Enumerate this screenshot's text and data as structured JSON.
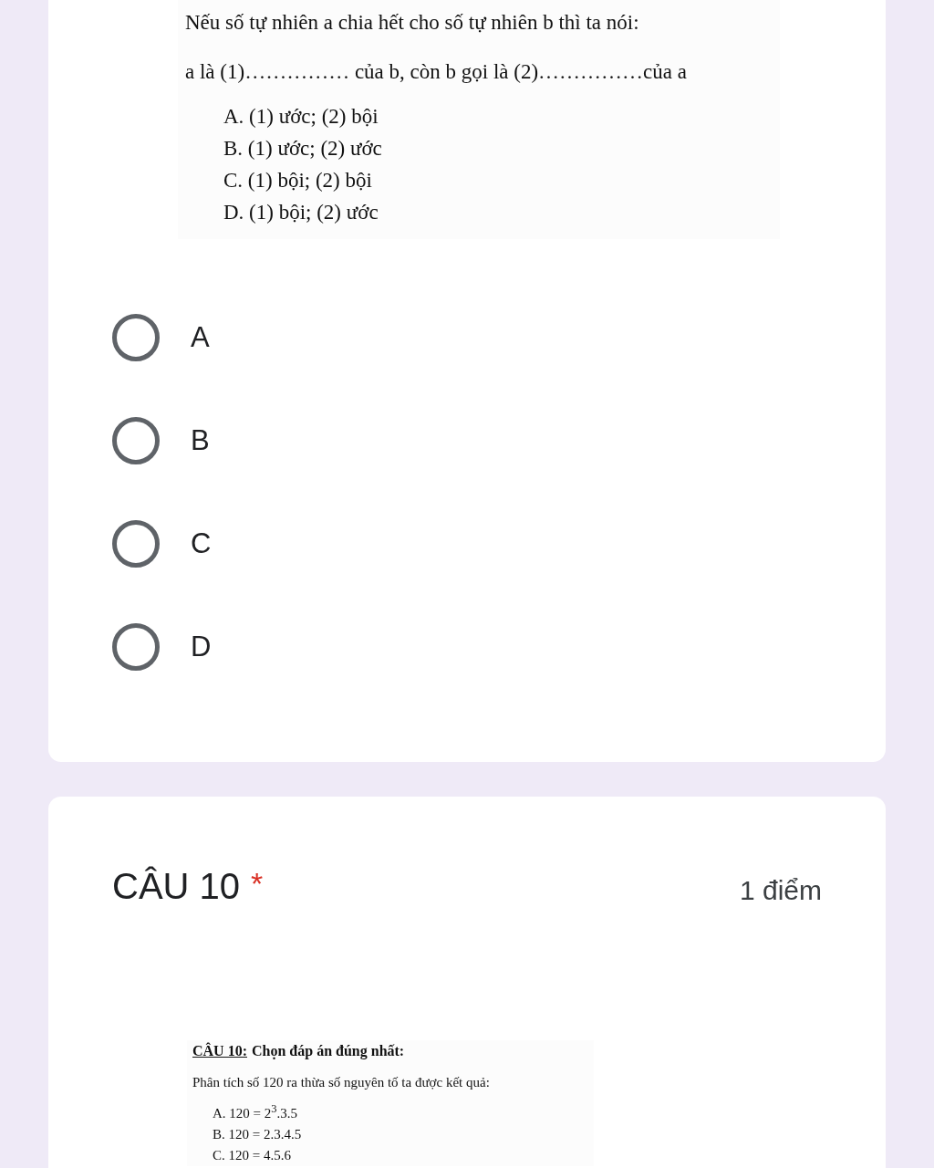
{
  "question_9": {
    "image_text": {
      "lines": [
        "Nếu số tự nhiên a chia hết cho số tự nhiên b thì ta nói:",
        "a là (1)…………… của b, còn b gọi là (2)……………của a"
      ],
      "options": [
        "A. (1) ước; (2) bội",
        "B. (1) ước; (2) ước",
        "C. (1) bội; (2) bội",
        "D. (1) bội; (2) ước"
      ]
    },
    "choices": [
      {
        "label": "A",
        "selected": false
      },
      {
        "label": "B",
        "selected": false
      },
      {
        "label": "C",
        "selected": false
      },
      {
        "label": "D",
        "selected": false
      }
    ]
  },
  "question_10": {
    "title": "CÂU 10",
    "required_mark": "*",
    "points": "1 điểm",
    "image_text": {
      "heading_label": "CÂU 10:",
      "heading_text": "Chọn đáp án đúng nhất:",
      "prompt": "Phân tích số 120 ra thừa số nguyên tố ta được kết quả:",
      "options": [
        "A. 120 = 2$^{3}$.3.5",
        "B. 120 = 2.3.4.5",
        "C. 120 = 4.5.6"
      ]
    }
  }
}
